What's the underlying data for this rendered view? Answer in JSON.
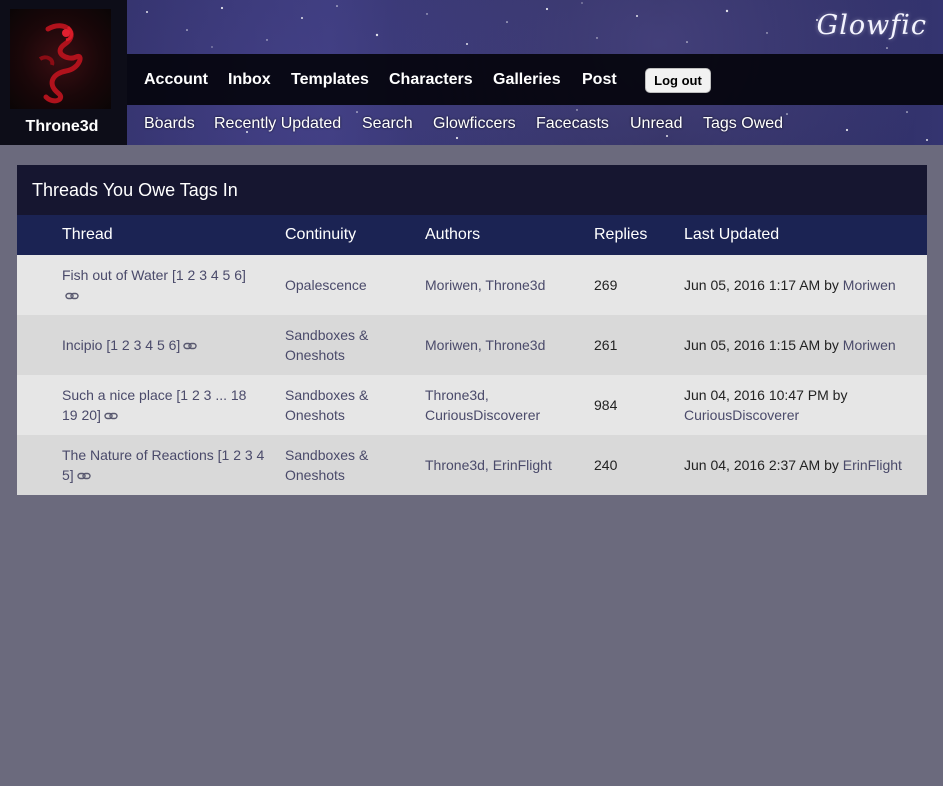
{
  "brand": {
    "logo": "Glowfic"
  },
  "user": {
    "name": "Throne3d"
  },
  "main_nav": [
    {
      "label": "Account"
    },
    {
      "label": "Inbox"
    },
    {
      "label": "Templates"
    },
    {
      "label": "Characters"
    },
    {
      "label": "Galleries"
    },
    {
      "label": "Post"
    }
  ],
  "logout_label": "Log out",
  "sub_nav": [
    {
      "label": "Boards"
    },
    {
      "label": "Recently Updated"
    },
    {
      "label": "Search"
    },
    {
      "label": "Glowficcers"
    },
    {
      "label": "Facecasts"
    },
    {
      "label": "Unread"
    },
    {
      "label": "Tags Owed"
    }
  ],
  "panel": {
    "title": "Threads You Owe Tags In",
    "columns": [
      "Thread",
      "Continuity",
      "Authors",
      "Replies",
      "Last Updated"
    ],
    "rows": [
      {
        "title": "Fish out of Water",
        "pages_line1": "[1 2 3 4 5 6]",
        "pages_line2": "",
        "continuity_line1": "Opalescence",
        "continuity_line2": "",
        "authors_line1": "Moriwen, Throne3d",
        "authors_line2": "",
        "replies": "269",
        "updated_line1": "Jun 05, 2016 1:17 AM by",
        "updated_user": "Moriwen",
        "updated_line2": ""
      },
      {
        "title": "Incipio",
        "pages_line1": "[1 2 3 4 5 6]",
        "pages_line2": "",
        "continuity_line1": "Sandboxes &",
        "continuity_line2": "Oneshots",
        "authors_line1": "Moriwen, Throne3d",
        "authors_line2": "",
        "replies": "261",
        "updated_line1": "Jun 05, 2016 1:15 AM by",
        "updated_user": "Moriwen",
        "updated_line2": ""
      },
      {
        "title": "Such a nice place",
        "pages_line1": "[1 2 3 ... 18",
        "pages_line2": "19 20]",
        "continuity_line1": "Sandboxes &",
        "continuity_line2": "Oneshots",
        "authors_line1": "Throne3d,",
        "authors_line2": "CuriousDiscoverer",
        "replies": "984",
        "updated_line1": "Jun 04, 2016 10:47 PM by",
        "updated_user": "",
        "updated_line2": "CuriousDiscoverer"
      },
      {
        "title": "The Nature of Reactions",
        "pages_line1": "[1 2 3 4",
        "pages_line2": "5]",
        "continuity_line1": "Sandboxes &",
        "continuity_line2": "Oneshots",
        "authors_line1": "Throne3d, ErinFlight",
        "authors_line2": "",
        "replies": "240",
        "updated_line1": "Jun 04, 2016 2:37 AM by",
        "updated_user": "ErinFlight",
        "updated_line2": ""
      }
    ]
  }
}
